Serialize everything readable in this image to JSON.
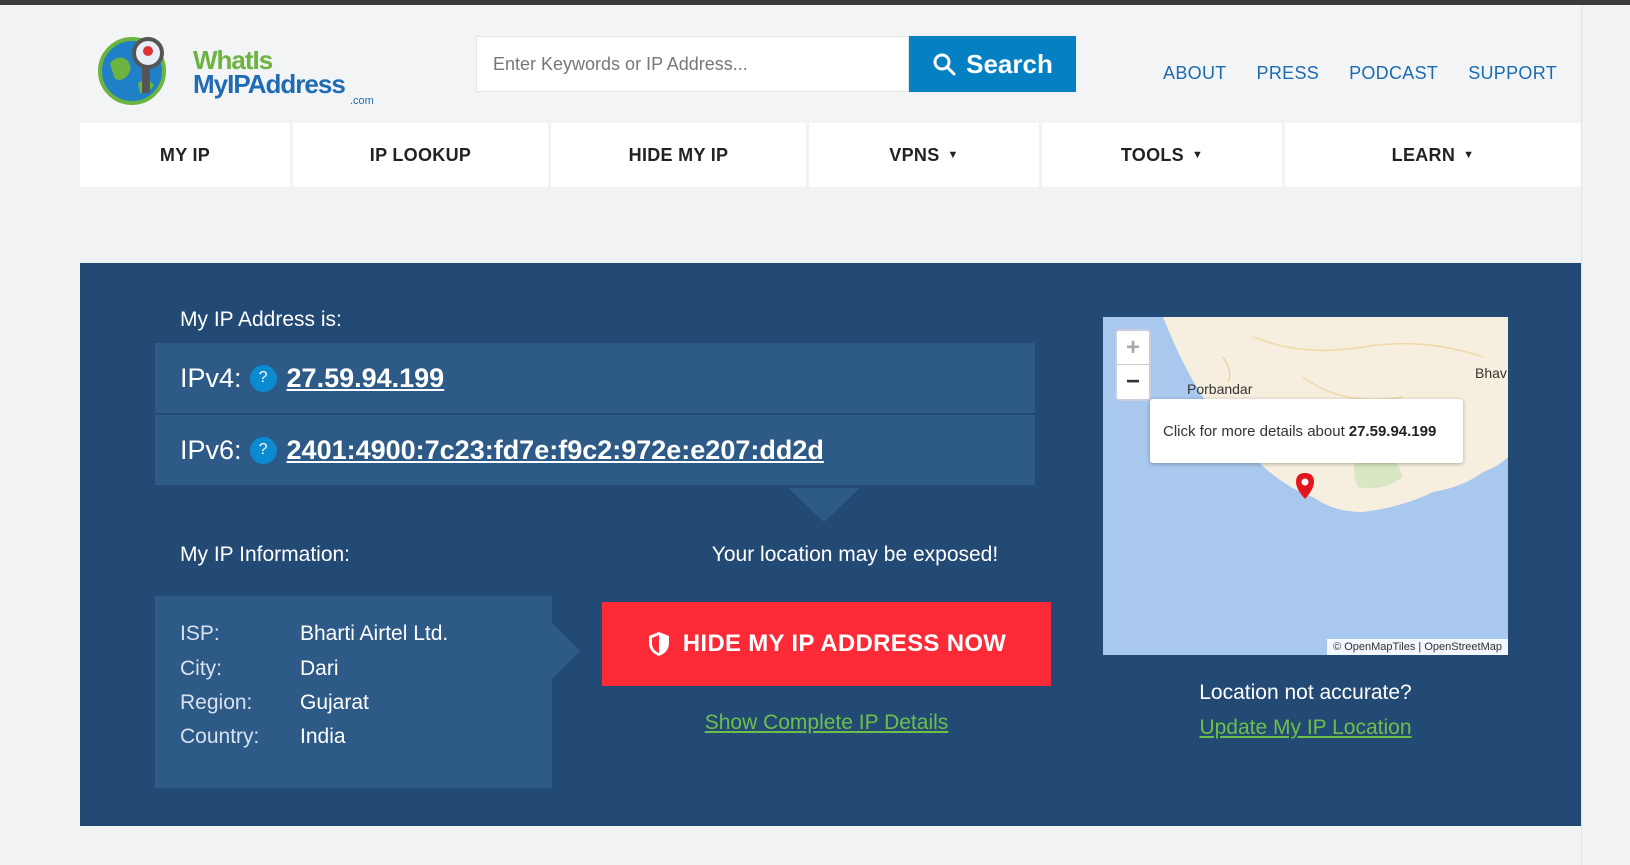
{
  "header": {
    "logo": {
      "line1": "WhatIs",
      "line2": "MyIPAddress",
      "suffix": ".com"
    },
    "search": {
      "placeholder": "Enter Keywords or IP Address...",
      "button_label": "Search"
    },
    "links": [
      "ABOUT",
      "PRESS",
      "PODCAST",
      "SUPPORT"
    ]
  },
  "nav": {
    "items": [
      {
        "label": "MY IP",
        "dropdown": false
      },
      {
        "label": "IP LOOKUP",
        "dropdown": false
      },
      {
        "label": "HIDE MY IP",
        "dropdown": false
      },
      {
        "label": "VPNS",
        "dropdown": true
      },
      {
        "label": "TOOLS",
        "dropdown": true
      },
      {
        "label": "LEARN",
        "dropdown": true
      }
    ],
    "caret": "▼"
  },
  "hero": {
    "ip_title": "My IP Address is:",
    "ipv4_label": "IPv4:",
    "ipv4_value": "27.59.94.199",
    "ipv6_label": "IPv6:",
    "ipv6_value": "2401:4900:7c23:fd7e:f9c2:972e:e207:dd2d",
    "help_glyph": "?",
    "info_title": "My IP Information:",
    "info": [
      {
        "key": "ISP:",
        "value": "Bharti Airtel Ltd."
      },
      {
        "key": "City:",
        "value": "Dari"
      },
      {
        "key": "Region:",
        "value": "Gujarat"
      },
      {
        "key": "Country:",
        "value": "India"
      }
    ],
    "exposed_text": "Your location may be exposed!",
    "hide_button": "HIDE MY IP ADDRESS NOW",
    "show_details_link": "Show Complete IP Details",
    "map": {
      "zoom_in": "+",
      "zoom_out": "−",
      "city1": "Porbandar",
      "city2": "Bhav",
      "popup_text": "Click for more details about",
      "popup_ip": "27.59.94.199",
      "attribution": "© OpenMapTiles | OpenStreetMap"
    },
    "location_question": "Location not accurate?",
    "update_link": "Update My IP Location"
  },
  "colors": {
    "brand_blue": "#0580c2",
    "hero_bg": "#234a74",
    "hide_red": "#fc2a37",
    "link_green": "#6cc04a"
  }
}
